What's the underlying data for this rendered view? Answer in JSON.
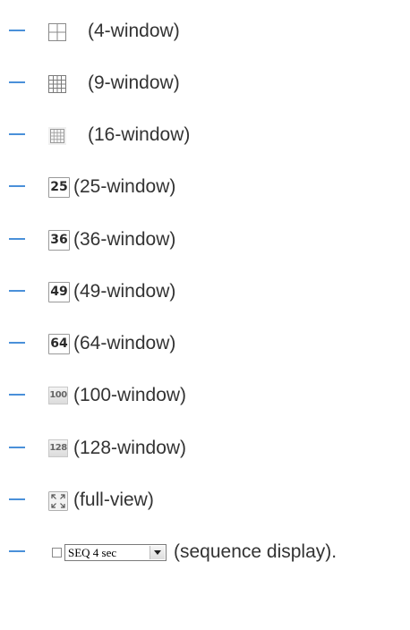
{
  "items": [
    {
      "icon": "grid-2x2-icon",
      "label": "(4-window)"
    },
    {
      "icon": "grid-3x3-icon",
      "label": "(9-window)"
    },
    {
      "icon": "grid-4x4-icon",
      "label": "(16-window)"
    },
    {
      "icon": "layout-25-icon",
      "icon_text": "25",
      "label": "(25-window)"
    },
    {
      "icon": "layout-36-icon",
      "icon_text": "36",
      "label": "(36-window)"
    },
    {
      "icon": "layout-49-icon",
      "icon_text": "49",
      "label": "(49-window)"
    },
    {
      "icon": "layout-64-icon",
      "icon_text": "64",
      "label": "(64-window)"
    },
    {
      "icon": "layout-100-icon",
      "icon_text": "100",
      "label": "(100-window)"
    },
    {
      "icon": "layout-128-icon",
      "icon_text": "128",
      "label": "(128-window)"
    },
    {
      "icon": "fullscreen-icon",
      "label": "(full-view)"
    },
    {
      "icon": "sequence-controls",
      "select_value": "SEQ 4 sec",
      "label": "(sequence display)."
    }
  ],
  "colors": {
    "bullet": "#4a90d9",
    "text": "#333333",
    "icon_border": "#9a9a9a"
  }
}
